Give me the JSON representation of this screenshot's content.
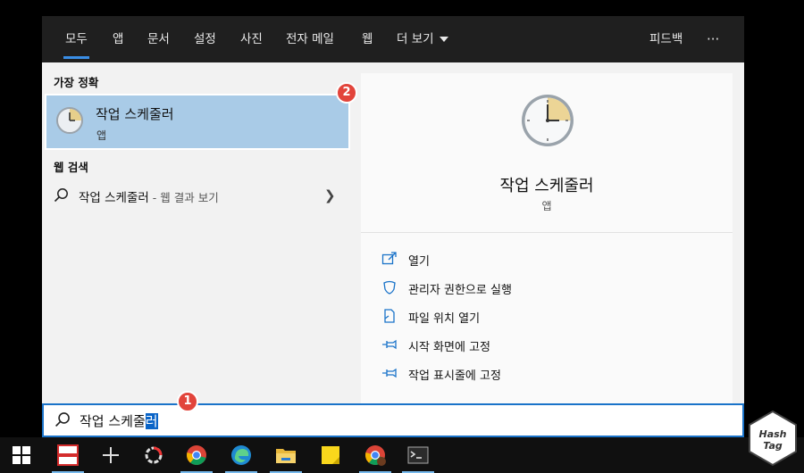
{
  "tabs": [
    {
      "label": "모두"
    },
    {
      "label": "앱"
    },
    {
      "label": "문서"
    },
    {
      "label": "설정"
    },
    {
      "label": "사진"
    },
    {
      "label": "전자 메일"
    },
    {
      "label": "웹"
    },
    {
      "label": "더 보기"
    }
  ],
  "header": {
    "feedback_label": "피드백",
    "more_label": "···"
  },
  "best_match": {
    "section_title": "가장 정확",
    "name": "작업 스케줄러",
    "kind": "앱"
  },
  "web_search": {
    "section_title": "웹 검색",
    "term": "작업 스케줄러",
    "suffix": " - 웹 결과 보기"
  },
  "preview": {
    "title": "작업 스케줄러",
    "kind": "앱"
  },
  "actions": [
    {
      "label": "열기",
      "icon": "open-icon"
    },
    {
      "label": "관리자 권한으로 실행",
      "icon": "shield-icon"
    },
    {
      "label": "파일 위치 열기",
      "icon": "file-location-icon"
    },
    {
      "label": "시작 화면에 고정",
      "icon": "pin-icon"
    },
    {
      "label": "작업 표시줄에 고정",
      "icon": "pin-icon"
    }
  ],
  "search": {
    "query_prefix": "작업 스케줄",
    "query_selected": "러"
  },
  "badges": {
    "one": "1",
    "two": "2"
  },
  "watermark": {
    "line1": "Hash",
    "line2": "Tag"
  },
  "taskbar": {
    "items": [
      "windows-start-icon",
      "app-red-icon",
      "plus-icon",
      "ring-app-icon",
      "chrome-icon",
      "edge-icon",
      "file-explorer-icon",
      "sticky-notes-icon",
      "chrome-profile-icon",
      "terminal-icon"
    ]
  },
  "colors": {
    "accent": "#3a8ee6",
    "selection": "#a9cbe7",
    "badge": "#e2443b",
    "topbar": "#1f1f1f"
  }
}
